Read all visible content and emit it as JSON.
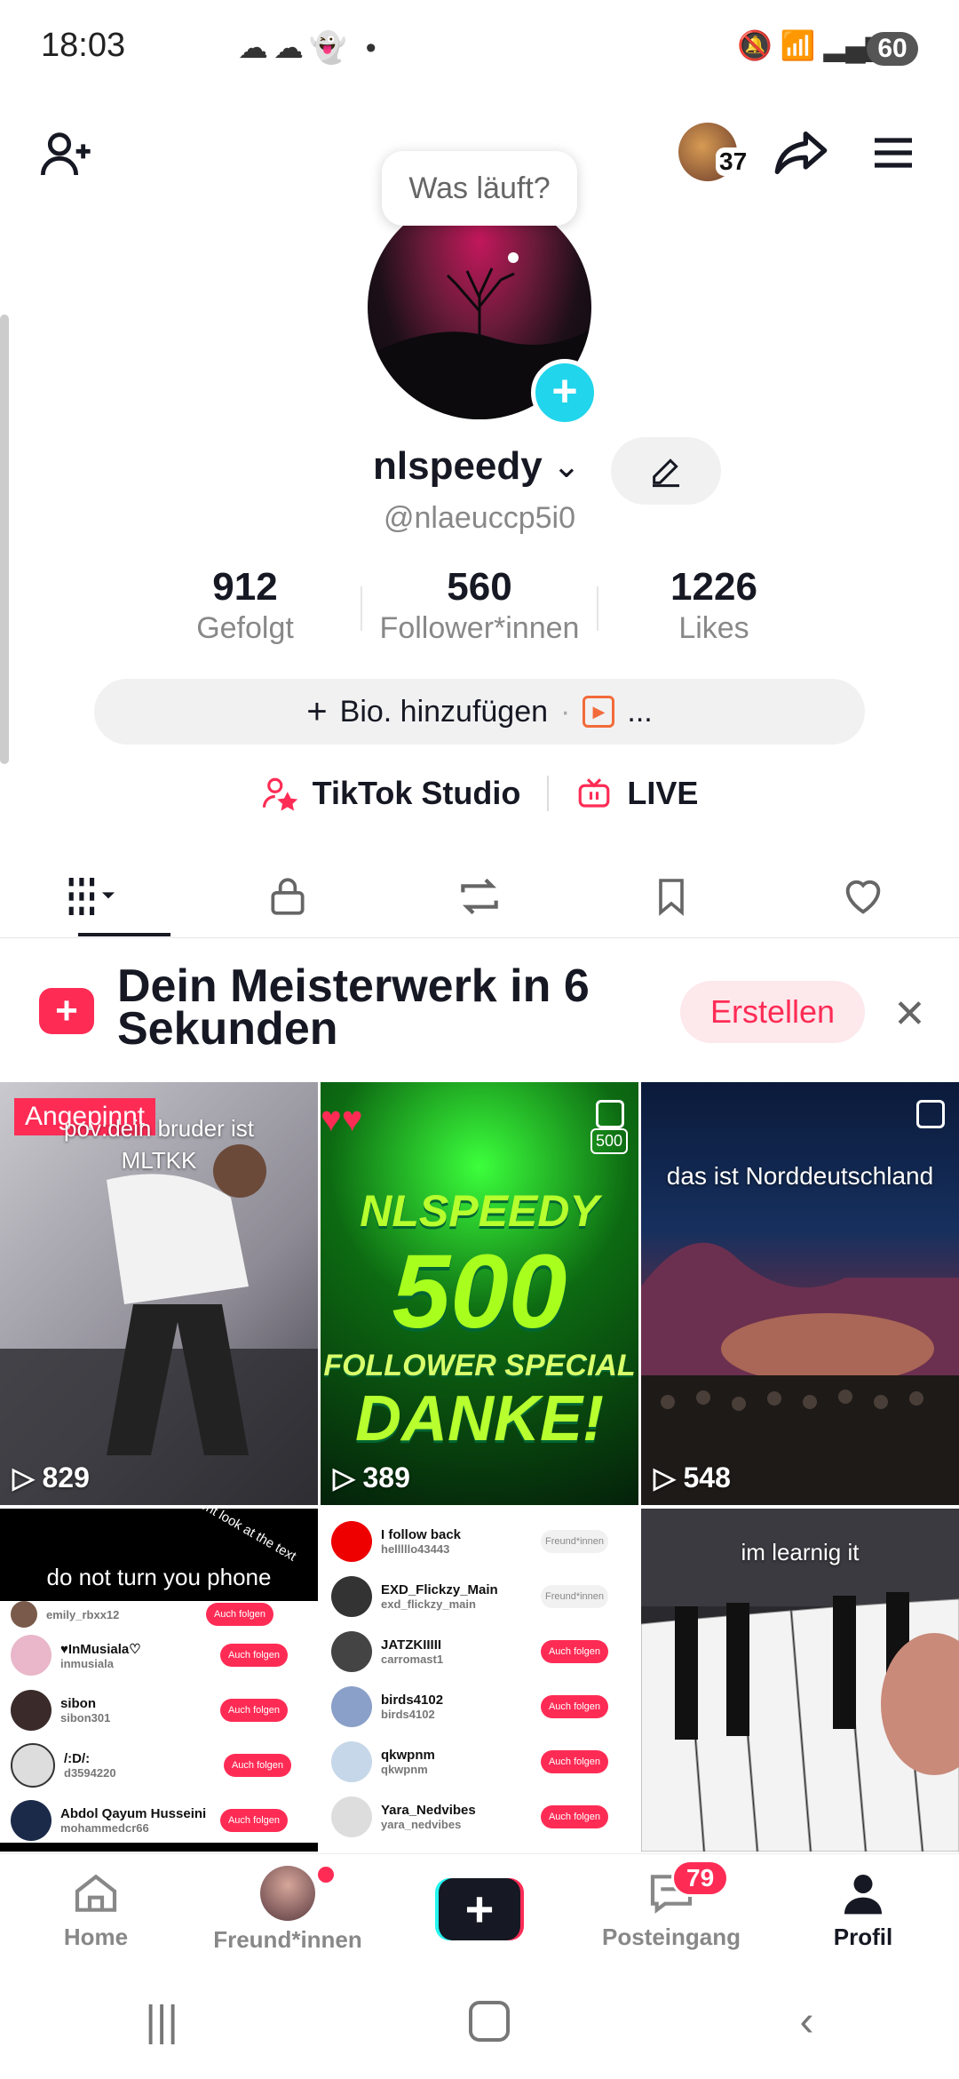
{
  "status_bar": {
    "time": "18:03",
    "battery": "60",
    "notif_icons": "☁☁👻 •",
    "sys_icons": "🔕 📶 ▂▄▆"
  },
  "header": {
    "avatar_count": "37"
  },
  "profile": {
    "bubble_text": "Was läuft?",
    "name": "nlspeedy",
    "handle": "@nlaeuccp5i0",
    "stats": [
      {
        "value": "912",
        "label": "Gefolgt"
      },
      {
        "value": "560",
        "label": "Follower*innen"
      },
      {
        "value": "1226",
        "label": "Likes"
      }
    ],
    "bio_button": "Bio. hinzufügen",
    "bio_more": "...",
    "studio_label": "TikTok Studio",
    "live_label": "LIVE"
  },
  "banner": {
    "title": "Dein Meisterwerk in 6 Sekunden",
    "cta": "Erstellen"
  },
  "videos": [
    {
      "pinned_label": "Angepinnt",
      "overlay": "pov:dein bruder ist MLTKK",
      "views": "829"
    },
    {
      "overlay_lines": [
        "NLSPEEDY",
        "500",
        "FOLLOWER SPECIAL",
        "DANKE!"
      ],
      "badge": "500",
      "views": "389"
    },
    {
      "overlay": "das ist Norddeutschland",
      "views": "548"
    },
    {
      "overlay": "do not turn you phone",
      "curved_text": "dont look at the text"
    },
    {
      "rows": [
        {
          "name": "I follow back",
          "sub": "helllllo43443",
          "btn": "Freund*innen"
        },
        {
          "name": "EXD_Flickzy_Main",
          "sub": "exd_flickzy_main",
          "btn": "Freund*innen"
        },
        {
          "name": "JATZKIIIII",
          "sub": "carromast1",
          "btn": "Auch folgen"
        },
        {
          "name": "birds4102",
          "sub": "birds4102",
          "btn": "Auch folgen"
        },
        {
          "name": "qkwpnm",
          "sub": "qkwpnm",
          "btn": "Auch folgen"
        },
        {
          "name": "Yara_Nedvibes",
          "sub": "yara_nedvibes",
          "btn": "Auch folgen"
        }
      ]
    },
    {
      "overlay": "im learnig it"
    }
  ],
  "video4_rows": [
    {
      "name": "",
      "sub": "emily_rbxx12",
      "btn": "Auch folgen"
    },
    {
      "name": "♥InMusiala♡",
      "sub": "inmusiala",
      "btn": "Auch folgen"
    },
    {
      "name": "sibon",
      "sub": "sibon301",
      "btn": "Auch folgen"
    },
    {
      "name": "/:D/:",
      "sub": "d3594220",
      "btn": "Auch folgen"
    },
    {
      "name": "Abdol Qayum Husseini",
      "sub": "mohammedcr66",
      "btn": "Auch folgen"
    }
  ],
  "nav": [
    {
      "label": "Home"
    },
    {
      "label": "Freund*innen"
    },
    {
      "label": ""
    },
    {
      "label": "Posteingang",
      "badge": "79"
    },
    {
      "label": "Profil"
    }
  ],
  "colors": {
    "accent": "#fe2c55",
    "cyan": "#25f4ee",
    "text": "#161823",
    "muted": "#888888"
  }
}
